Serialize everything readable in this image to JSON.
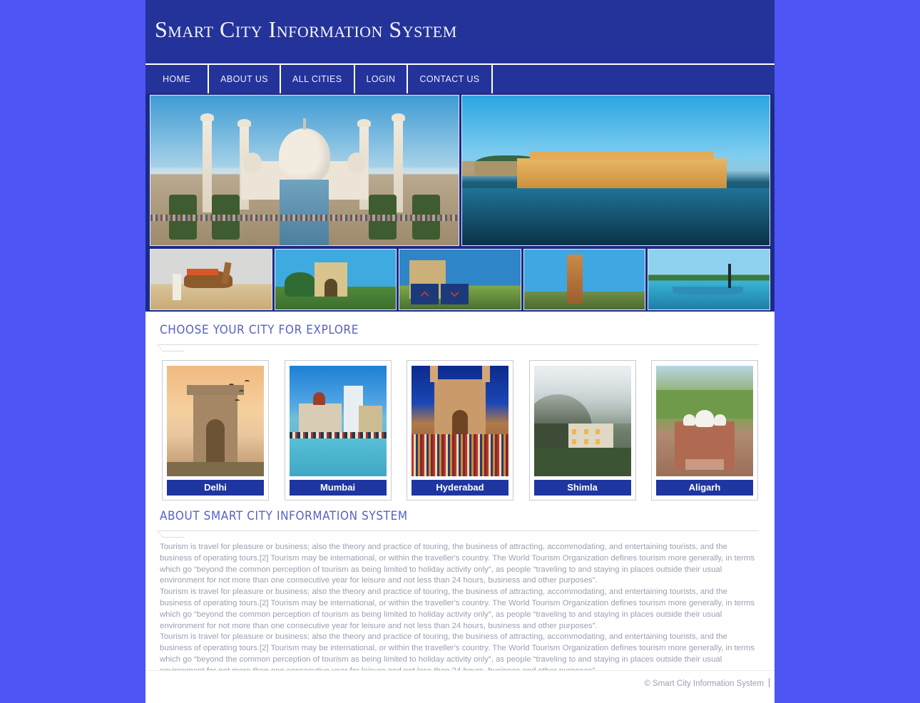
{
  "header": {
    "title": "Smart City Information System"
  },
  "nav": {
    "items": [
      {
        "label": "HOME",
        "name": "nav-home"
      },
      {
        "label": "ABOUT US",
        "name": "nav-about-us"
      },
      {
        "label": "ALL CITIES",
        "name": "nav-all-cities"
      },
      {
        "label": "LOGIN",
        "name": "nav-login"
      },
      {
        "label": "CONTACT US",
        "name": "nav-contact-us"
      }
    ]
  },
  "slider": {
    "slides": [
      {
        "caption": "Taj Mahal, Agra"
      },
      {
        "caption": "Jal Mahal, Jaipur"
      }
    ],
    "thumbnails": [
      {
        "caption": "Camel in desert"
      },
      {
        "caption": "India Gate"
      },
      {
        "caption": "Temple"
      },
      {
        "caption": "Qutub Minar"
      },
      {
        "caption": "Backwater boat"
      }
    ],
    "prev_icon": "chevron-up-icon",
    "next_icon": "chevron-down-icon"
  },
  "sections": {
    "cities_heading": "CHOOSE YOUR CITY FOR EXPLORE",
    "about_heading": "ABOUT SMART CITY INFORMATION SYSTEM"
  },
  "cities": [
    {
      "name": "Delhi"
    },
    {
      "name": "Mumbai"
    },
    {
      "name": "Hyderabad"
    },
    {
      "name": "Shimla"
    },
    {
      "name": "Aligarh"
    }
  ],
  "about": {
    "paragraphs": [
      "Tourism is travel for pleasure or business; also the theory and practice of touring, the business of attracting, accommodating, and entertaining tourists, and the business of operating tours.[2] Tourism may be international, or within the traveller's country. The World Tourism Organization defines tourism more generally, in terms which go “beyond the common perception of tourism as being limited to holiday activity only”, as people “traveling to and staying in places outside their usual environment for not more than one consecutive year for leisure and not less than 24 hours, business and other purposes”.",
      "Tourism is travel for pleasure or business; also the theory and practice of touring, the business of attracting, accommodating, and entertaining tourists, and the business of operating tours.[2] Tourism may be international, or within the traveller's country. The World Tourism Organization defines tourism more generally, in terms which go “beyond the common perception of tourism as being limited to holiday activity only”, as people “traveling to and staying in places outside their usual environment for not more than one consecutive year for leisure and not less than 24 hours, business and other purposes”.",
      "Tourism is travel for pleasure or business; also the theory and practice of touring, the business of attracting, accommodating, and entertaining tourists, and the business of operating tours.[2] Tourism may be international, or within the traveller's country. The World Tourism Organization defines tourism more generally, in terms which go “beyond the common perception of tourism as being limited to holiday activity only”, as people “traveling to and staying in places outside their usual environment for not more than one consecutive year for leisure and not less than 24 hours, business and other purposes”."
    ]
  },
  "footer": {
    "copyright": "© Smart City Information System"
  },
  "colors": {
    "page_background": "#4d55f5",
    "header_blue": "#24339a",
    "caption_blue": "#1f35a0",
    "heading_text": "#5560c8",
    "body_text": "#9aa0b4",
    "arrow_red": "#c43a3a"
  }
}
